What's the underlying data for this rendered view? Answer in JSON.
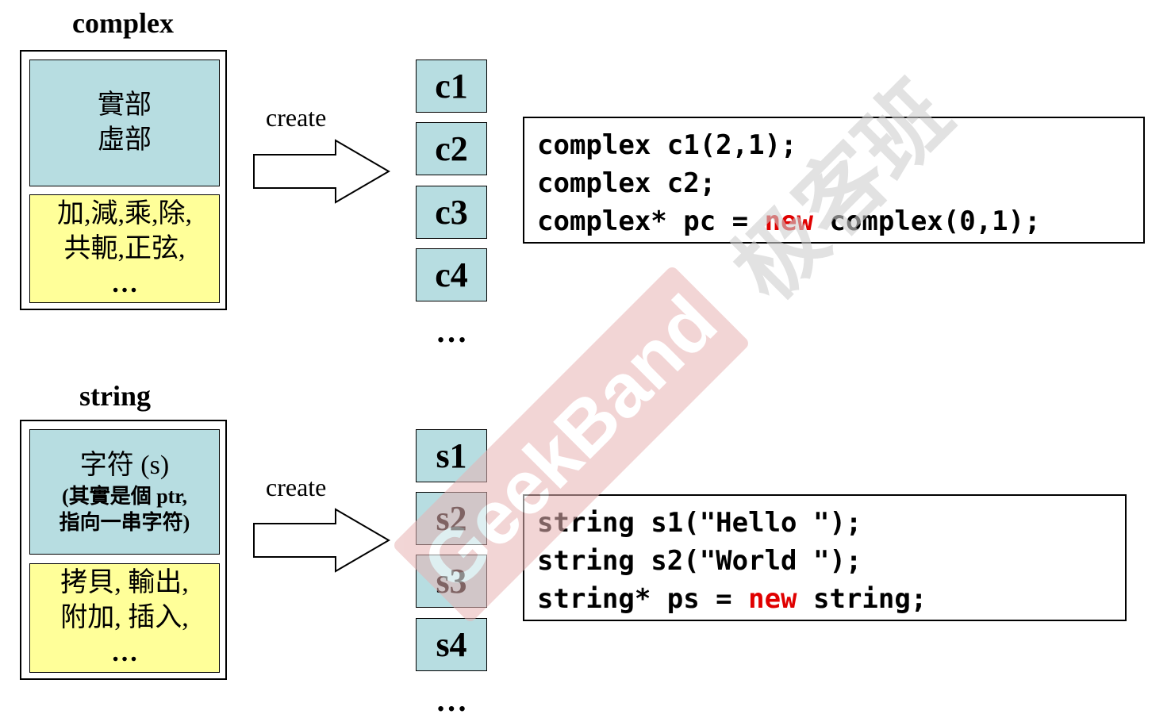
{
  "complex_section": {
    "title": "complex",
    "data_block": [
      "實部",
      "虛部"
    ],
    "methods_block": [
      "加,減,乘,除,",
      "共軛,正弦,",
      "…"
    ],
    "create_label": "create",
    "objects": [
      "c1",
      "c2",
      "c3",
      "c4"
    ],
    "ellipsis": "…",
    "code": {
      "line1": "complex c1(2,1);",
      "line2": "complex c2;",
      "line3_prefix": "complex* pc = ",
      "line3_keyword": "new",
      "line3_suffix": " complex(0,1);"
    }
  },
  "string_section": {
    "title": "string",
    "data_block": [
      "字符 (s)",
      "(其實是個 ptr,",
      "指向一串字符)"
    ],
    "methods_block": [
      "拷貝, 輸出,",
      "附加, 插入,",
      "…"
    ],
    "create_label": "create",
    "objects": [
      "s1",
      "s2",
      "s3",
      "s4"
    ],
    "ellipsis": "…",
    "code": {
      "line1": "string s1(\"Hello \");",
      "line2": "string s2(\"World \");",
      "line3_prefix": "string* ps = ",
      "line3_keyword": "new",
      "line3_suffix": " string;"
    }
  },
  "watermark": {
    "logo_text": "GeekBand",
    "chinese_text": "极客班",
    "logo_color": "#e8b4b4",
    "chinese_color": "#d0d0d0"
  },
  "colors": {
    "object_fill": "#b7dde1",
    "methods_fill": "#ffff99",
    "keyword": "#e00000"
  }
}
